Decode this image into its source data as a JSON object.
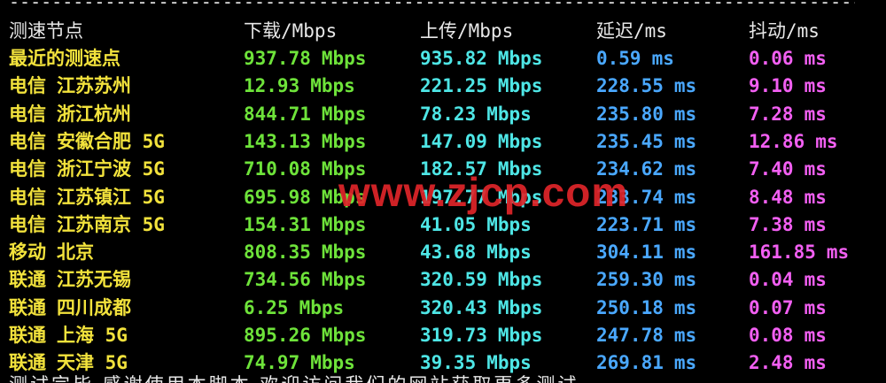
{
  "divider": "--------------------------------------------------------------------------------------------------------------------------------------",
  "header": {
    "node": "测速节点",
    "download": "下载/Mbps",
    "upload": "上传/Mbps",
    "latency": "延迟/ms",
    "jitter": "抖动/ms"
  },
  "colors": {
    "background": "#000000",
    "node": "#f2e23c",
    "download": "#6ee33a",
    "upload": "#4ee6e6",
    "latency": "#4aa8ff",
    "jitter": "#f25ff2",
    "header": "#e8e8e8",
    "watermark": "#e0252a"
  },
  "rows": [
    {
      "isp": "最近的测速点",
      "loc": "",
      "dl": "937.78",
      "dl_unit": "Mbps",
      "ul": "935.82",
      "ul_unit": "Mbps",
      "lat": "0.59",
      "lat_unit": "ms",
      "jit": "0.06",
      "jit_unit": "ms"
    },
    {
      "isp": "电信",
      "loc": "江苏苏州",
      "dl": "12.93",
      "dl_unit": "Mbps",
      "ul": "221.25",
      "ul_unit": "Mbps",
      "lat": "228.55",
      "lat_unit": "ms",
      "jit": "9.10",
      "jit_unit": "ms"
    },
    {
      "isp": "电信",
      "loc": "浙江杭州",
      "dl": "844.71",
      "dl_unit": "Mbps",
      "ul": "78.23",
      "ul_unit": "Mbps",
      "lat": "235.80",
      "lat_unit": "ms",
      "jit": "7.28",
      "jit_unit": "ms"
    },
    {
      "isp": "电信",
      "loc": "安徽合肥 5G",
      "dl": "143.13",
      "dl_unit": "Mbps",
      "ul": "147.09",
      "ul_unit": "Mbps",
      "lat": "235.45",
      "lat_unit": "ms",
      "jit": "12.86",
      "jit_unit": "ms"
    },
    {
      "isp": "电信",
      "loc": "浙江宁波 5G",
      "dl": "710.08",
      "dl_unit": "Mbps",
      "ul": "182.57",
      "ul_unit": "Mbps",
      "lat": "234.62",
      "lat_unit": "ms",
      "jit": "7.40",
      "jit_unit": "ms"
    },
    {
      "isp": "电信",
      "loc": "江苏镇江 5G",
      "dl": "695.98",
      "dl_unit": "Mbps",
      "ul": "197.77",
      "ul_unit": "Mbps",
      "lat": "233.74",
      "lat_unit": "ms",
      "jit": "8.48",
      "jit_unit": "ms"
    },
    {
      "isp": "电信",
      "loc": "江苏南京 5G",
      "dl": "154.31",
      "dl_unit": "Mbps",
      "ul": "41.05",
      "ul_unit": "Mbps",
      "lat": "223.71",
      "lat_unit": "ms",
      "jit": "7.38",
      "jit_unit": "ms"
    },
    {
      "isp": "移动",
      "loc": "北京",
      "dl": "808.35",
      "dl_unit": "Mbps",
      "ul": "43.68",
      "ul_unit": "Mbps",
      "lat": "304.11",
      "lat_unit": "ms",
      "jit": "161.85",
      "jit_unit": "ms"
    },
    {
      "isp": "联通",
      "loc": "江苏无锡",
      "dl": "734.56",
      "dl_unit": "Mbps",
      "ul": "320.59",
      "ul_unit": "Mbps",
      "lat": "259.30",
      "lat_unit": "ms",
      "jit": "0.04",
      "jit_unit": "ms"
    },
    {
      "isp": "联通",
      "loc": "四川成都",
      "dl": "6.25",
      "dl_unit": "Mbps",
      "ul": "320.43",
      "ul_unit": "Mbps",
      "lat": "250.18",
      "lat_unit": "ms",
      "jit": "0.07",
      "jit_unit": "ms"
    },
    {
      "isp": "联通",
      "loc": "上海 5G",
      "dl": "895.26",
      "dl_unit": "Mbps",
      "ul": "319.73",
      "ul_unit": "Mbps",
      "lat": "247.78",
      "lat_unit": "ms",
      "jit": "0.08",
      "jit_unit": "ms"
    },
    {
      "isp": "联通",
      "loc": "天津 5G",
      "dl": "74.97",
      "dl_unit": "Mbps",
      "ul": "39.35",
      "ul_unit": "Mbps",
      "lat": "269.81",
      "lat_unit": "ms",
      "jit": "2.48",
      "jit_unit": "ms"
    }
  ],
  "watermark": "www.zjcp.com",
  "footer": "测试完毕,感谢使用本脚本,欢迎访问我们的网站获取更多测试"
}
